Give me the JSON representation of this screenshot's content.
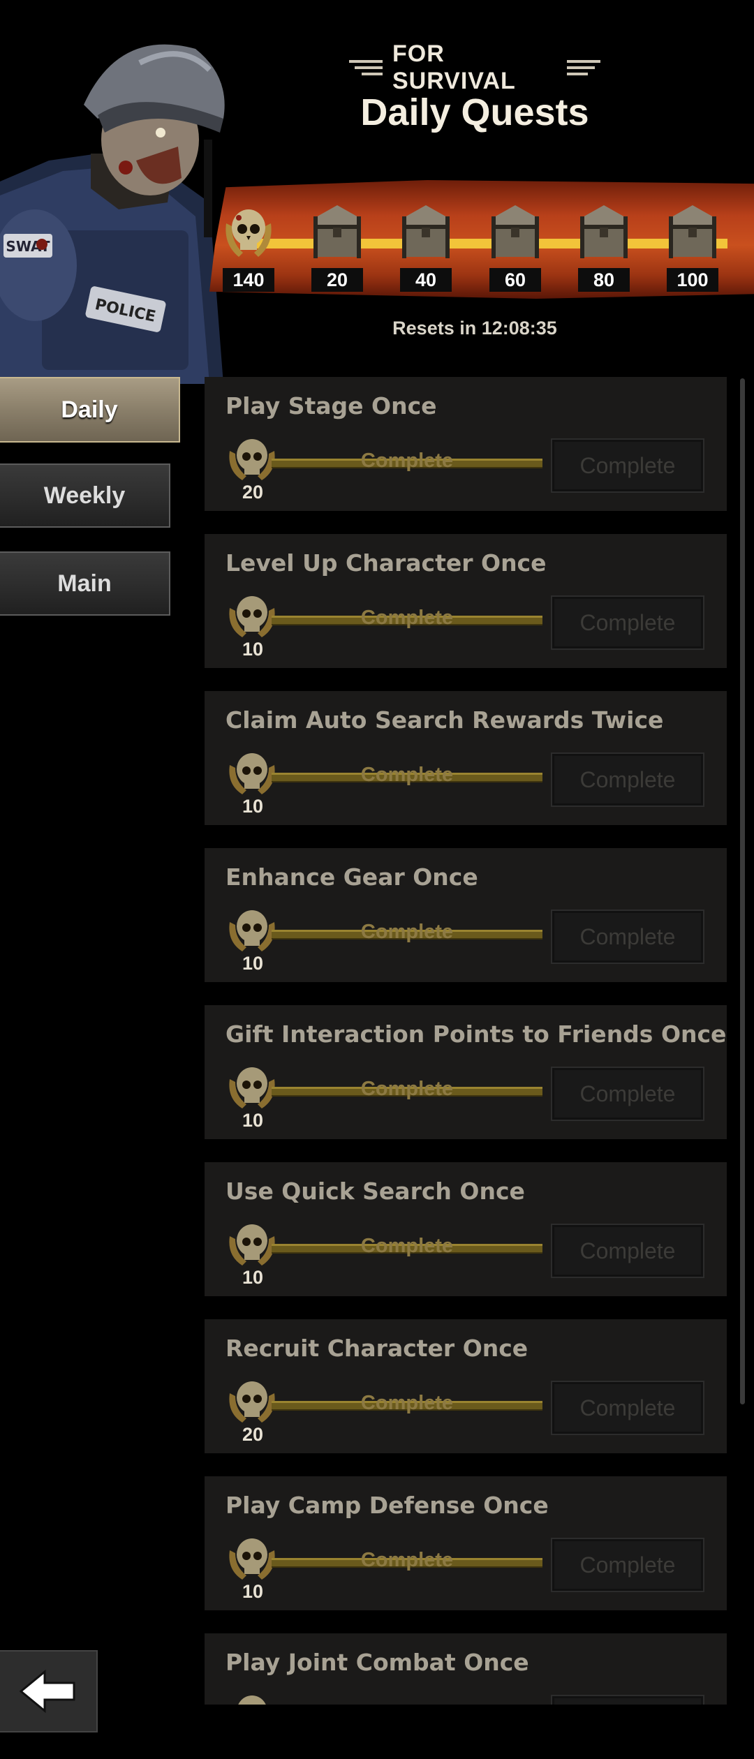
{
  "header": {
    "subtitle": "FOR SURVIVAL",
    "title": "Daily Quests",
    "resets_text": "Resets in 12:08:35"
  },
  "milestones": [
    {
      "value": "140",
      "icon": "skull-laurel-icon"
    },
    {
      "value": "20",
      "icon": "chest-icon"
    },
    {
      "value": "40",
      "icon": "chest-icon"
    },
    {
      "value": "60",
      "icon": "chest-icon"
    },
    {
      "value": "80",
      "icon": "chest-icon"
    },
    {
      "value": "100",
      "icon": "chest-icon"
    }
  ],
  "tabs": [
    {
      "label": "Daily",
      "active": true
    },
    {
      "label": "Weekly",
      "active": false
    },
    {
      "label": "Main",
      "active": false
    }
  ],
  "quests": [
    {
      "title": "Play Stage Once",
      "reward": "20",
      "progress_text": "Complete",
      "button": "Complete"
    },
    {
      "title": "Level Up Character Once",
      "reward": "10",
      "progress_text": "Complete",
      "button": "Complete"
    },
    {
      "title": "Claim Auto Search Rewards Twice",
      "reward": "10",
      "progress_text": "Complete",
      "button": "Complete"
    },
    {
      "title": "Enhance Gear Once",
      "reward": "10",
      "progress_text": "Complete",
      "button": "Complete"
    },
    {
      "title": "Gift Interaction Points to Friends Once",
      "reward": "10",
      "progress_text": "Complete",
      "button": "Complete"
    },
    {
      "title": "Use Quick Search Once",
      "reward": "10",
      "progress_text": "Complete",
      "button": "Complete"
    },
    {
      "title": "Recruit Character Once",
      "reward": "20",
      "progress_text": "Complete",
      "button": "Complete"
    },
    {
      "title": "Play Camp Defense Once",
      "reward": "10",
      "progress_text": "Complete",
      "button": "Complete"
    },
    {
      "title": "Play Joint Combat Once",
      "reward": "",
      "progress_text": "",
      "button": ""
    }
  ],
  "colors": {
    "banner": "#c9501e",
    "track": "#f2c43a",
    "card_bg": "#1b1a19",
    "progress_fill": "#6a5a1c"
  },
  "icons": {
    "back": "back-arrow-icon",
    "portrait": "zombie-police-portrait"
  }
}
